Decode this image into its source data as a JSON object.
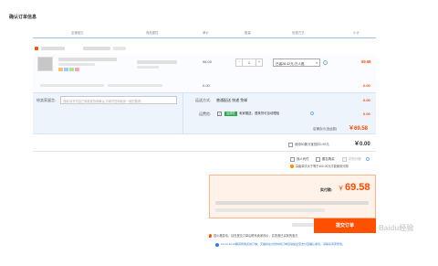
{
  "page": {
    "title": "确认订单信息"
  },
  "columns": [
    "店铺宝贝",
    "商品属性",
    "单价",
    "数量",
    "优惠方式",
    "小计"
  ],
  "order": {
    "unit_price": "98.00",
    "quantity": "1",
    "discount_select": "已省28.42元:万人推",
    "subtotal": "69.58",
    "sub_price": "0.00",
    "sub_price_right": "0.00"
  },
  "buyer_note": {
    "label": "给卖家留言:",
    "placeholder": "选填:填写内容已和卖家协商确认(可填写您和卖家一致的要求)"
  },
  "shipping": {
    "label": "运送方式:",
    "value": "普通配送 快递 免邮",
    "fee": "0.00"
  },
  "insurance": {
    "label": "运费险:",
    "badge": "运费险",
    "text": "卖家赠送，退换货可自动理赔",
    "fee": "0.00"
  },
  "store_total": {
    "label": "店铺合计(含运费)",
    "value": "￥69.58"
  },
  "points": {
    "label": "使用90集分宝抵扣0.90元",
    "value": "￥0.00"
  },
  "options": {
    "others_pay": "找人代付",
    "anonymous": "匿名购买",
    "credit": "花呗分期"
  },
  "warning": "高级单次大于等于400.00元才能使用分期",
  "summary": {
    "paid_label": "实付款:",
    "paid_value": "69.58",
    "currency": "￥"
  },
  "submit_label": "提交订单",
  "notice": "若价格变动，请在提交订单后联系卖家改价，并查看已买到的宝贝",
  "footnote": "12.12-13.15期间所购买的订单，天猫将在付款时将订单自动提交至支付宝确认收货，请联系商家修改。",
  "watermark": "Baidu经验",
  "colors": {
    "accent": "#ff4a00",
    "button": "#ff5000",
    "box_border": "#ffb08c",
    "box_bg": "#fff2e8"
  }
}
